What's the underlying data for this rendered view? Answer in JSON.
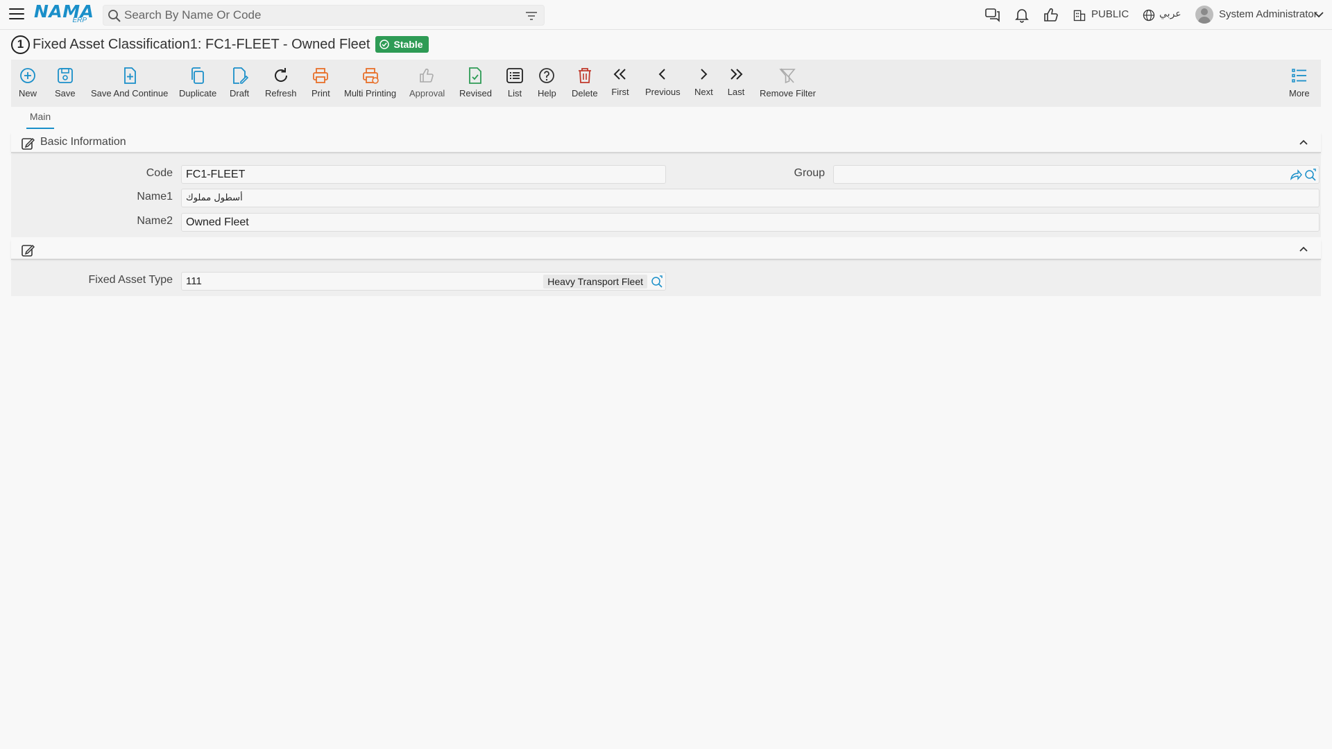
{
  "search": {
    "placeholder": "Search By Name Or Code"
  },
  "logo": {
    "main": "NAMA",
    "sub": "ERP"
  },
  "topbar": {
    "branch": "PUBLIC",
    "language": "عربي",
    "user": "System Administrator"
  },
  "page": {
    "number": "1",
    "title": "Fixed Asset Classification1: FC1-FLEET - Owned Fleet",
    "status": "Stable"
  },
  "toolbar": {
    "new": "New",
    "save": "Save",
    "save_continue": "Save And Continue",
    "duplicate": "Duplicate",
    "draft": "Draft",
    "refresh": "Refresh",
    "print": "Print",
    "multi_printing": "Multi Printing",
    "approval": "Approval",
    "revised": "Revised",
    "list": "List",
    "help": "Help",
    "delete": "Delete",
    "first": "First",
    "previous": "Previous",
    "next": "Next",
    "last": "Last",
    "remove_filter": "Remove Filter",
    "more": "More"
  },
  "tabs": {
    "main": "Main"
  },
  "basic_info": {
    "title": "Basic Information",
    "code_label": "Code",
    "code_value": "FC1-FLEET",
    "group_label": "Group",
    "group_value": "",
    "name1_label": "Name1",
    "name1_value": "أسطول مملوك",
    "name2_label": "Name2",
    "name2_value": "Owned Fleet"
  },
  "second_section": {
    "fa_type_label": "Fixed Asset Type",
    "fa_type_code": "111",
    "fa_type_name": "Heavy Transport Fleet"
  },
  "colors": {
    "accent": "#1a8fc9",
    "status_green": "#2e9b55",
    "print_orange": "#e8702a",
    "delete_red": "#c0392b"
  }
}
